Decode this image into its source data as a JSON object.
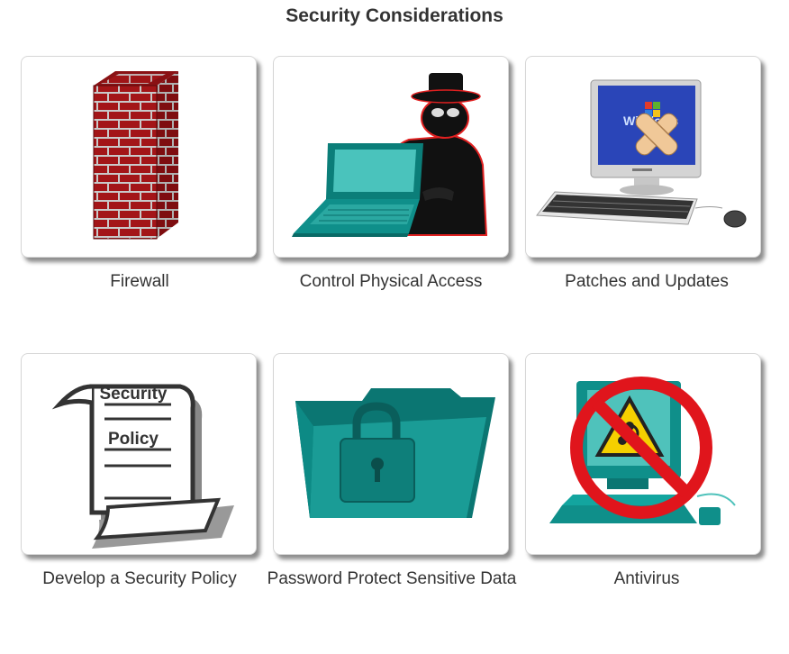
{
  "title": "Security Considerations",
  "cards": [
    {
      "label": "Firewall",
      "icon": "firewall-icon"
    },
    {
      "label": "Control Physical Access",
      "icon": "intruder-laptop-icon"
    },
    {
      "label": "Patches and Updates",
      "icon": "patched-computer-icon"
    },
    {
      "label": "Develop a Security Policy",
      "icon": "security-policy-scroll-icon"
    },
    {
      "label": "Password Protect Sensitive Data",
      "icon": "locked-folder-icon"
    },
    {
      "label": "Antivirus",
      "icon": "no-biohazard-computer-icon"
    }
  ],
  "policy_scroll": {
    "line1": "Security",
    "line2": "Policy"
  },
  "screen_text": {
    "win": "Windows"
  },
  "colors": {
    "brick": "#a31518",
    "teal": "#0f8f8a",
    "screen_blue": "#2a45b8",
    "prohibit_red": "#e0151c",
    "hazard_yellow": "#f5d000"
  }
}
